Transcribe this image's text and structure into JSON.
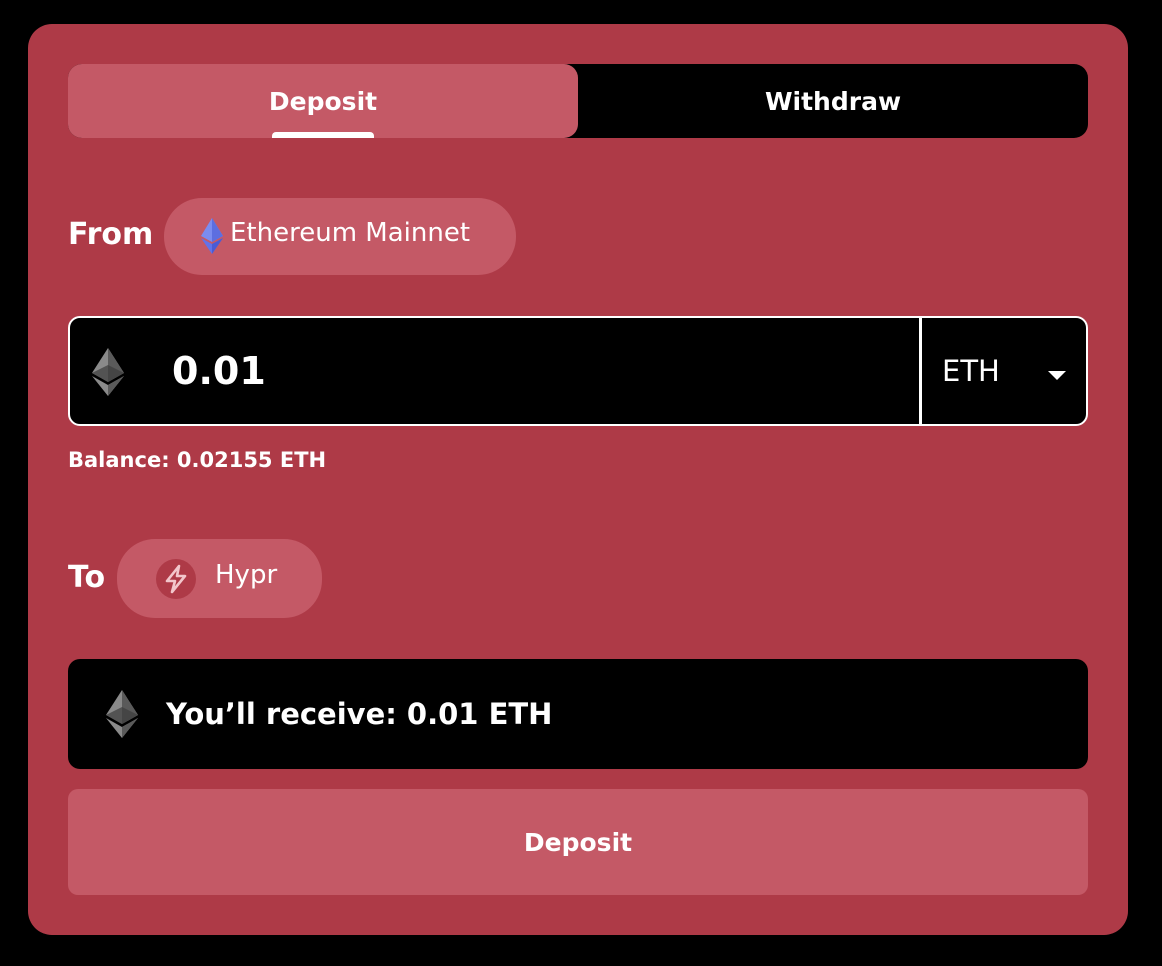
{
  "tabs": {
    "deposit_label": "Deposit",
    "withdraw_label": "Withdraw",
    "active": "Deposit"
  },
  "from": {
    "label": "From",
    "network": "Ethereum Mainnet",
    "network_icon": "ethereum-icon"
  },
  "amount": {
    "value": "0.01",
    "token_icon": "ethereum-icon",
    "token": "ETH",
    "dropdown_icon": "caret-down-icon"
  },
  "balance": {
    "text": "Balance: 0.02155 ETH"
  },
  "to": {
    "label": "To",
    "network": "Hypr",
    "network_icon": "hypr-bolt-icon"
  },
  "receive": {
    "text": "You’ll receive: 0.01 ETH",
    "icon": "ethereum-icon"
  },
  "submit": {
    "label": "Deposit"
  },
  "colors": {
    "card_background": "#ae3a47",
    "accent_pill": "#c45966",
    "dark_surface": "#000000",
    "ethereum_blue": "#6272e8"
  }
}
